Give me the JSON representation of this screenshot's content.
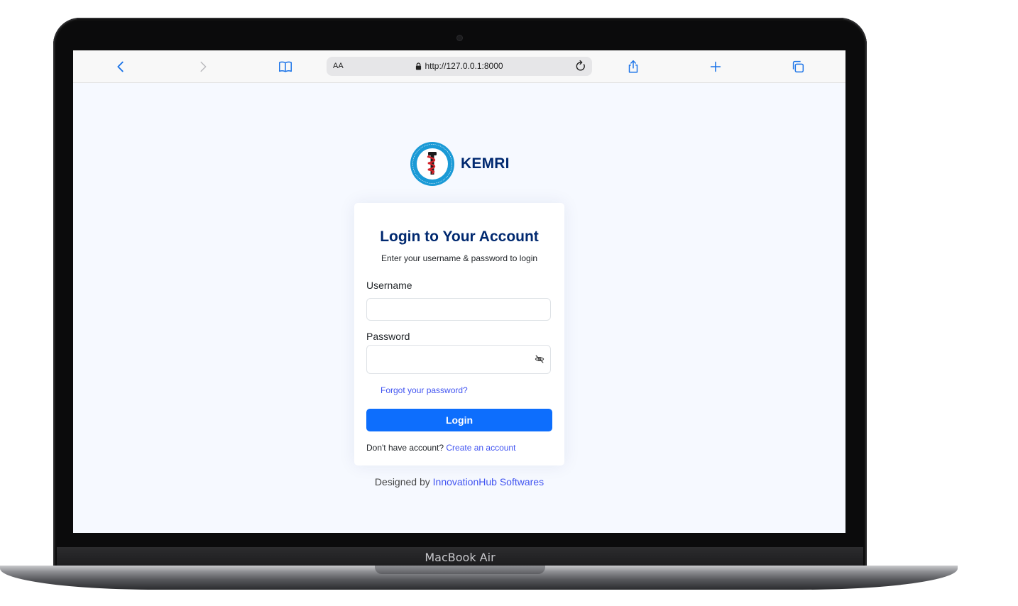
{
  "device": {
    "model_label": "MacBook Air"
  },
  "browser": {
    "text_size_label": "AA",
    "url": "http://127.0.0.1:8000"
  },
  "brand": {
    "name": "KEMRI"
  },
  "login": {
    "title": "Login to Your Account",
    "subtitle": "Enter your username & password to login",
    "username_label": "Username",
    "username_value": "",
    "password_label": "Password",
    "password_value": "",
    "forgot_link": "Forgot your password?",
    "login_button": "Login",
    "signup_prompt": "Don't have account?",
    "signup_link": "Create an account"
  },
  "footer": {
    "designed_by": "Designed by",
    "company_link": "InnovationHub Softwares"
  },
  "colors": {
    "primary_button": "#0d6efd",
    "heading": "#012970",
    "link": "#4154f1",
    "page_background": "#f6f9ff"
  }
}
